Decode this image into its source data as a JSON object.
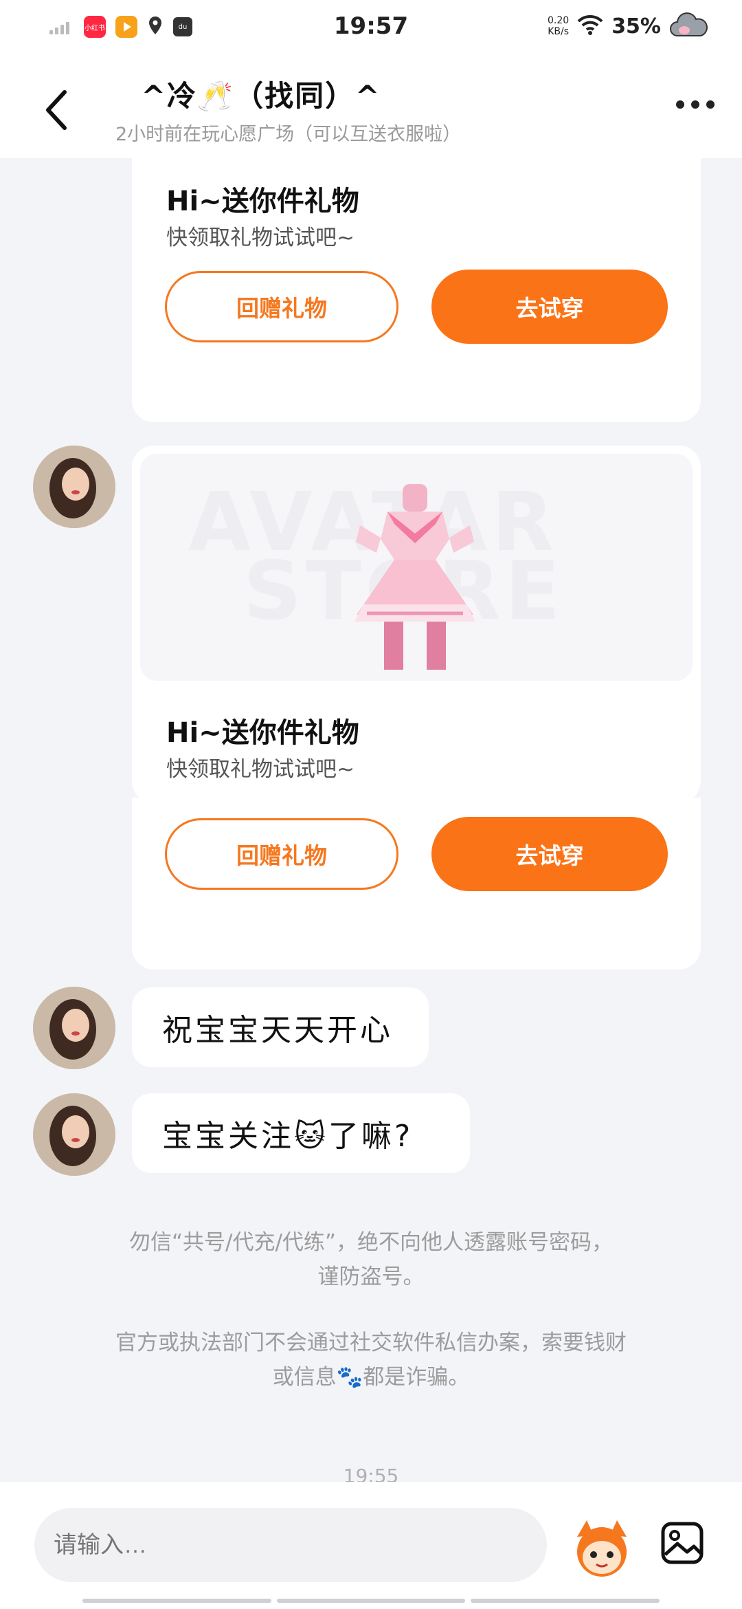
{
  "status_bar": {
    "time": "19:57",
    "app_icons": [
      "小红书",
      "AcFun",
      "du"
    ],
    "net_speed_value": "0.20",
    "net_speed_unit": "KB/s",
    "battery": "35%"
  },
  "header": {
    "title": "^冷🥂（找同）^",
    "subtitle": "2小时前在玩心愿广场（可以互送衣服啦）"
  },
  "messages": {
    "card1": {
      "title": "Hi~送你件礼物",
      "subtitle": "快领取礼物试试吧~",
      "return_gift": "回赠礼物",
      "try_on": "去试穿"
    },
    "card2": {
      "watermark_line1": "AVATAR",
      "watermark_line2": "STORE",
      "title": "Hi~送你件礼物",
      "subtitle": "快领取礼物试试吧~",
      "return_gift": "回赠礼物",
      "try_on": "去试穿"
    },
    "bubble1": "祝宝宝天天开心",
    "bubble2": "宝宝关注🐱了嘛?"
  },
  "notices": {
    "line1": "勿信“共号/代充/代练”，绝不向他人透露账号密码，",
    "line2": "谨防盗号。",
    "line3": "官方或执法部门不会通过社交软件私信办案，索要钱财",
    "line4": "或信息🐾都是诈骗。"
  },
  "timestamp": "19:55",
  "input": {
    "placeholder": "请输入…"
  },
  "colors": {
    "accent": "#fb7317",
    "background": "#f3f4f8"
  }
}
